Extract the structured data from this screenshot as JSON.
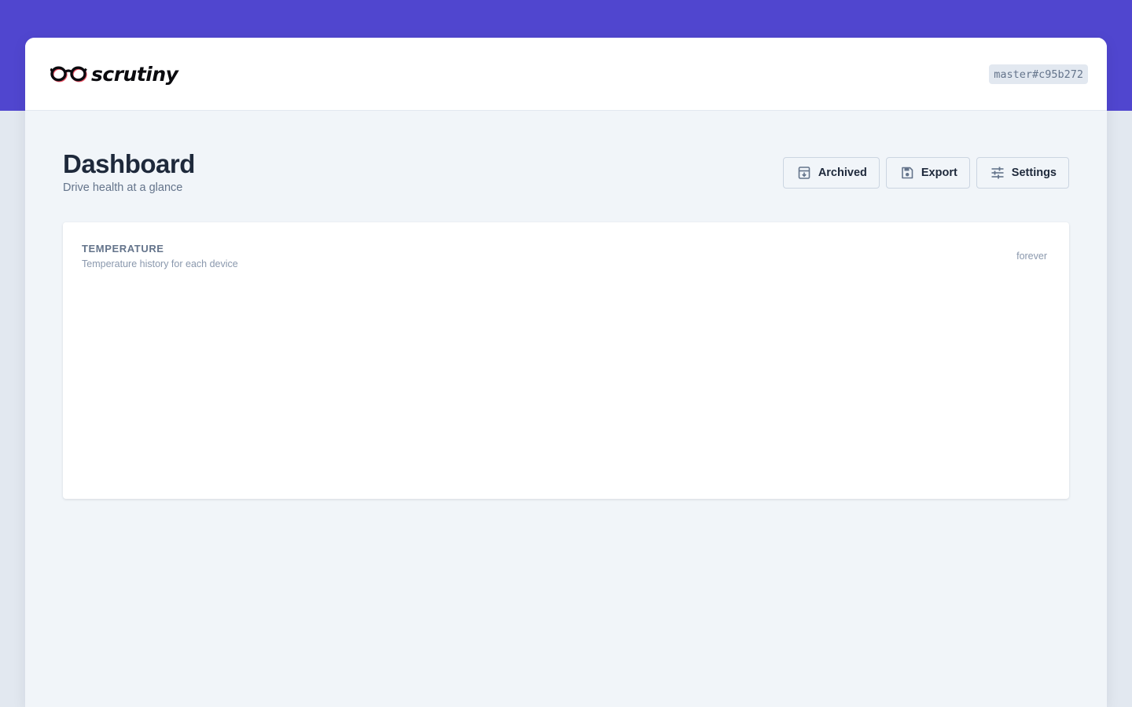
{
  "header": {
    "brand": "scrutiny",
    "version": "master#c95b272"
  },
  "page": {
    "title": "Dashboard",
    "subtitle": "Drive health at a glance"
  },
  "actions": {
    "archived_label": "Archived",
    "export_label": "Export",
    "settings_label": "Settings"
  },
  "temperature_card": {
    "title": "TEMPERATURE",
    "subtitle": "Temperature history for each device",
    "range_label": "forever"
  },
  "icons": {
    "logo": "glasses-icon",
    "archived": "archive-box-icon",
    "export": "save-disk-icon",
    "settings": "sliders-icon"
  },
  "colors": {
    "accent": "#5046cf",
    "background": "#f1f5f9",
    "text_primary": "#1e293b",
    "text_muted": "#64748b"
  }
}
